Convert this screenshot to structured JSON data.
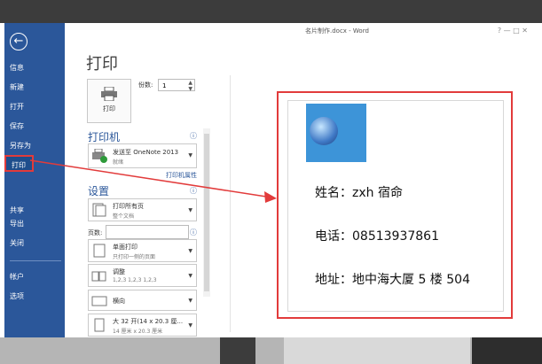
{
  "window": {
    "title": "名片制作.docx - Word",
    "controls": "?  —  □  ✕"
  },
  "sidebar": {
    "back_label": "←",
    "items": [
      {
        "label": "信息"
      },
      {
        "label": "新建"
      },
      {
        "label": "打开"
      },
      {
        "label": "保存"
      },
      {
        "label": "另存为"
      },
      {
        "label": "打印",
        "selected": true
      },
      {
        "label": "共享"
      },
      {
        "label": "导出"
      },
      {
        "label": "关闭"
      },
      {
        "label": "帐户"
      },
      {
        "label": "选项"
      }
    ]
  },
  "print": {
    "heading": "打印",
    "button_label": "打印",
    "copies_label": "份数:",
    "copies_value": "1",
    "printer_heading": "打印机",
    "printer_name": "发送至 OneNote 2013",
    "printer_status": "就绪",
    "printer_props": "打印机属性",
    "settings_heading": "设置",
    "pages_label": "页数:",
    "settings": [
      {
        "line1": "打印所有页",
        "line2": "整个文档"
      },
      {
        "line1": "单面打印",
        "line2": "只打印一侧的页面"
      },
      {
        "line1": "调整",
        "line2": "1,2,3    1,2,3    1,2,3"
      },
      {
        "line1": "横向",
        "line2": ""
      },
      {
        "line1": "大 32 开(14 x 20.3 厘...",
        "line2": "14 厘米 x 20.3 厘米"
      }
    ]
  },
  "preview": {
    "name": "姓名：zxh 宿命",
    "phone": "电话：08513937861",
    "address": "地址：地中海大厦 5 楼 504"
  },
  "colors": {
    "accent": "#2b579a",
    "highlight": "#e23b3b"
  }
}
